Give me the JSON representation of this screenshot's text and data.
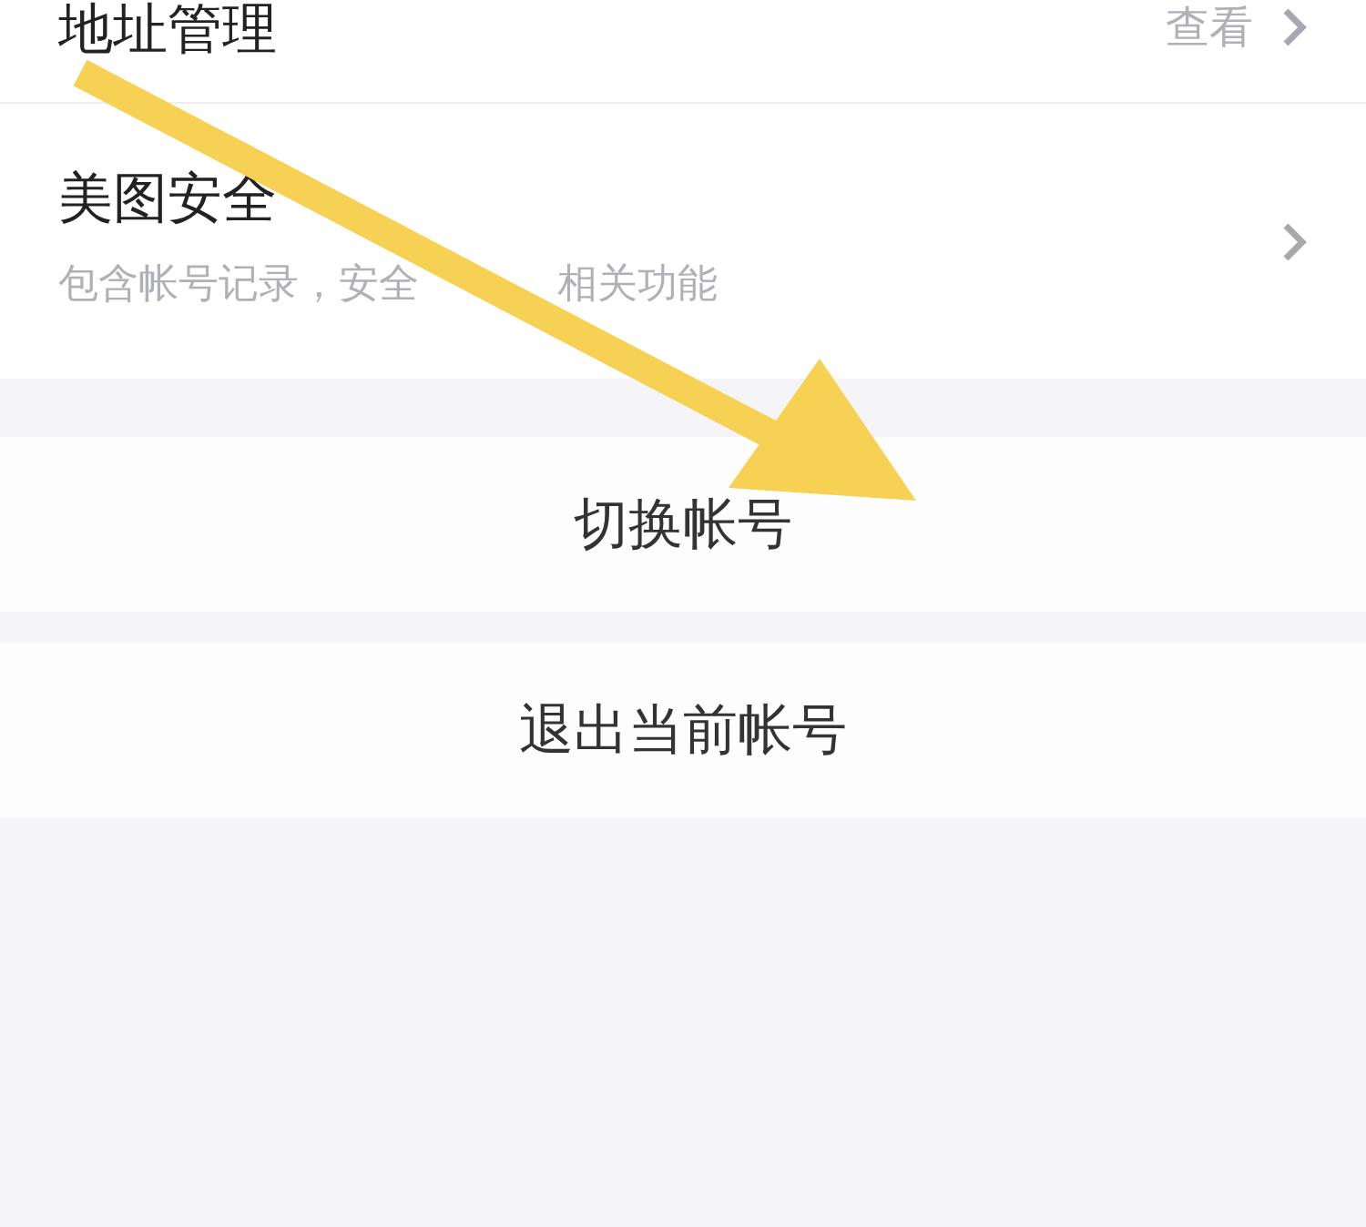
{
  "settings_rows": [
    {
      "title_parts": [
        "地址管理"
      ],
      "value": "查看"
    },
    {
      "title_parts": [
        "美图安全"
      ],
      "subtitle_parts": [
        "包含帐号记录，安全",
        "相关功能"
      ]
    }
  ],
  "actions": [
    {
      "label": "切换帐号"
    },
    {
      "label": "退出当前帐号"
    }
  ]
}
